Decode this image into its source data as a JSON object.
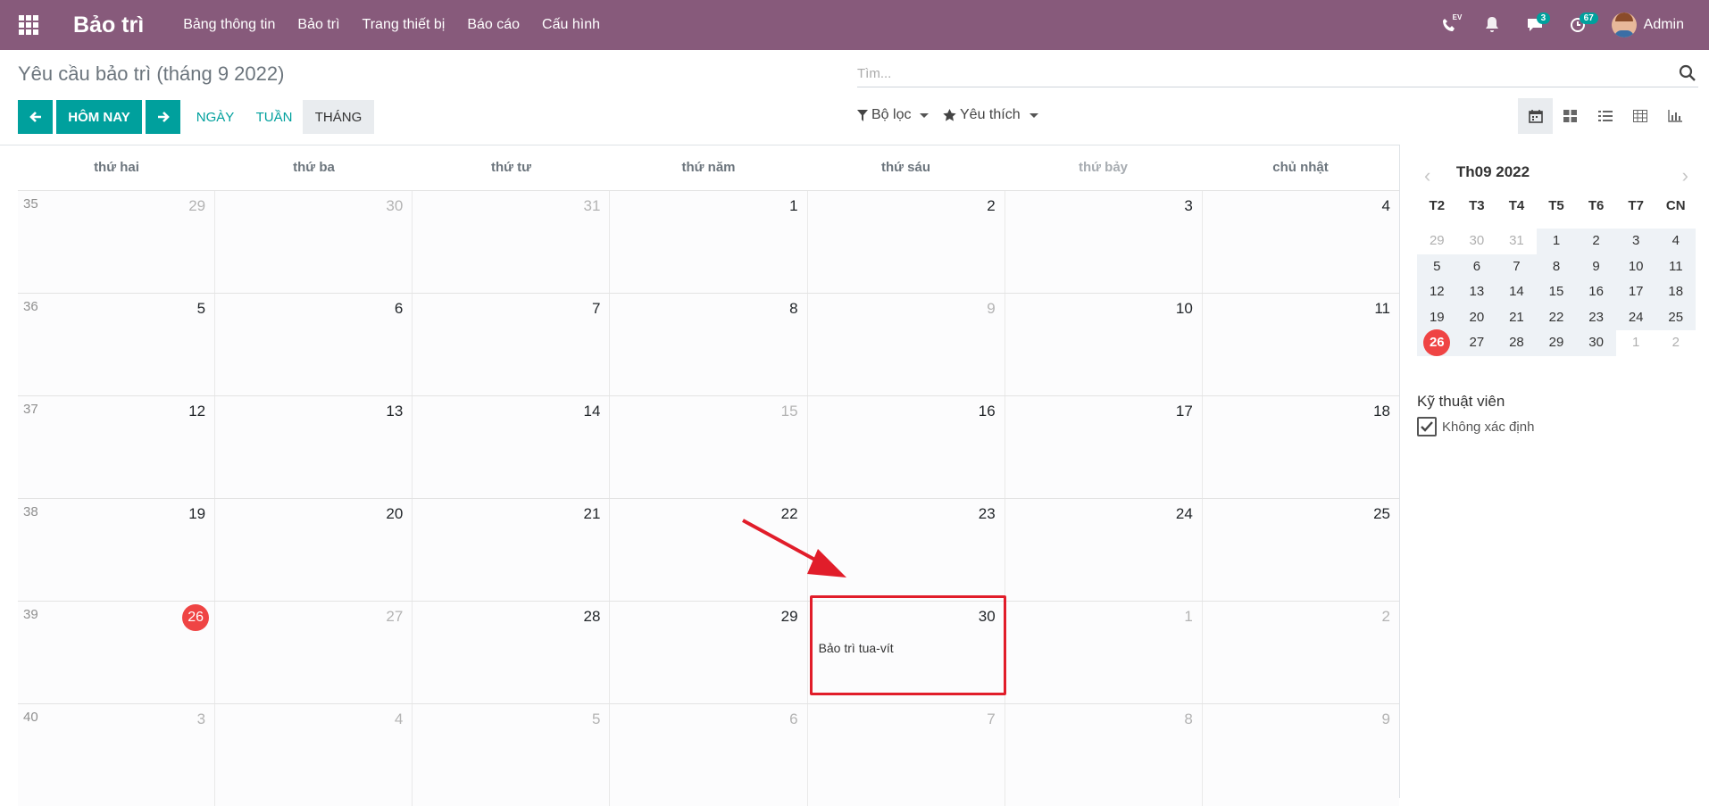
{
  "app": {
    "title": "Bảo trì",
    "menu": [
      "Bảng thông tin",
      "Bảo trì",
      "Trang thiết bị",
      "Báo cáo",
      "Cấu hình"
    ],
    "badges": {
      "ev": "EV",
      "messages": "3",
      "activities": "67"
    },
    "user": "Admin"
  },
  "page": {
    "title": "Yêu cầu bảo trì (tháng 9 2022)",
    "search_placeholder": "Tìm...",
    "today_label": "HÔM NAY",
    "scale": {
      "day": "NGÀY",
      "week": "TUẦN",
      "month": "THÁNG"
    },
    "filter_label": "Bộ lọc",
    "favorite_label": "Yêu thích"
  },
  "calendar": {
    "weekdays": [
      "thứ hai",
      "thứ ba",
      "thứ tư",
      "thứ năm",
      "thứ sáu",
      "thứ bảy",
      "chủ nhật"
    ],
    "weeks": [
      {
        "no": "35",
        "days": [
          {
            "d": "29",
            "o": true
          },
          {
            "d": "30",
            "o": true
          },
          {
            "d": "31",
            "o": true
          },
          {
            "d": "1"
          },
          {
            "d": "2"
          },
          {
            "d": "3"
          },
          {
            "d": "4"
          }
        ]
      },
      {
        "no": "36",
        "days": [
          {
            "d": "5"
          },
          {
            "d": "6"
          },
          {
            "d": "7"
          },
          {
            "d": "8"
          },
          {
            "d": "9",
            "o": true
          },
          {
            "d": "10"
          },
          {
            "d": "11"
          }
        ]
      },
      {
        "no": "37",
        "days": [
          {
            "d": "12"
          },
          {
            "d": "13"
          },
          {
            "d": "14"
          },
          {
            "d": "15",
            "o": true
          },
          {
            "d": "16"
          },
          {
            "d": "17"
          },
          {
            "d": "18"
          }
        ]
      },
      {
        "no": "38",
        "days": [
          {
            "d": "19"
          },
          {
            "d": "20"
          },
          {
            "d": "21"
          },
          {
            "d": "22"
          },
          {
            "d": "23"
          },
          {
            "d": "24"
          },
          {
            "d": "25"
          }
        ]
      },
      {
        "no": "39",
        "days": [
          {
            "d": "26",
            "t": true
          },
          {
            "d": "27",
            "o": true
          },
          {
            "d": "28"
          },
          {
            "d": "29"
          },
          {
            "d": "30",
            "e": "Bảo trì tua-vít"
          },
          {
            "d": "1",
            "o": true
          },
          {
            "d": "2",
            "o": true
          }
        ]
      },
      {
        "no": "40",
        "days": [
          {
            "d": "3",
            "o": true
          },
          {
            "d": "4",
            "o": true
          },
          {
            "d": "5",
            "o": true
          },
          {
            "d": "6",
            "o": true
          },
          {
            "d": "7",
            "o": true
          },
          {
            "d": "8",
            "o": true
          },
          {
            "d": "9",
            "o": true
          }
        ]
      }
    ]
  },
  "sidebar": {
    "mini_title": "Th09 2022",
    "mini_dow": [
      "T2",
      "T3",
      "T4",
      "T5",
      "T6",
      "T7",
      "CN"
    ],
    "mini_weeks": [
      [
        {
          "d": "29",
          "o": true
        },
        {
          "d": "30",
          "o": true
        },
        {
          "d": "31",
          "o": true
        },
        {
          "d": "1"
        },
        {
          "d": "2"
        },
        {
          "d": "3"
        },
        {
          "d": "4"
        }
      ],
      [
        {
          "d": "5"
        },
        {
          "d": "6"
        },
        {
          "d": "7"
        },
        {
          "d": "8"
        },
        {
          "d": "9"
        },
        {
          "d": "10"
        },
        {
          "d": "11"
        }
      ],
      [
        {
          "d": "12"
        },
        {
          "d": "13"
        },
        {
          "d": "14"
        },
        {
          "d": "15"
        },
        {
          "d": "16"
        },
        {
          "d": "17"
        },
        {
          "d": "18"
        }
      ],
      [
        {
          "d": "19"
        },
        {
          "d": "20"
        },
        {
          "d": "21"
        },
        {
          "d": "22"
        },
        {
          "d": "23"
        },
        {
          "d": "24"
        },
        {
          "d": "25"
        }
      ],
      [
        {
          "d": "26",
          "t": true
        },
        {
          "d": "27"
        },
        {
          "d": "28"
        },
        {
          "d": "29"
        },
        {
          "d": "30"
        },
        {
          "d": "1",
          "o": true
        },
        {
          "d": "2",
          "o": true
        }
      ]
    ],
    "filter_title": "Kỹ thuật viên",
    "filter_item": "Không xác định"
  },
  "colors": {
    "brand": "#875a7b",
    "accent": "#00a09d",
    "today": "#ef4444",
    "highlight": "#e11d2a"
  }
}
